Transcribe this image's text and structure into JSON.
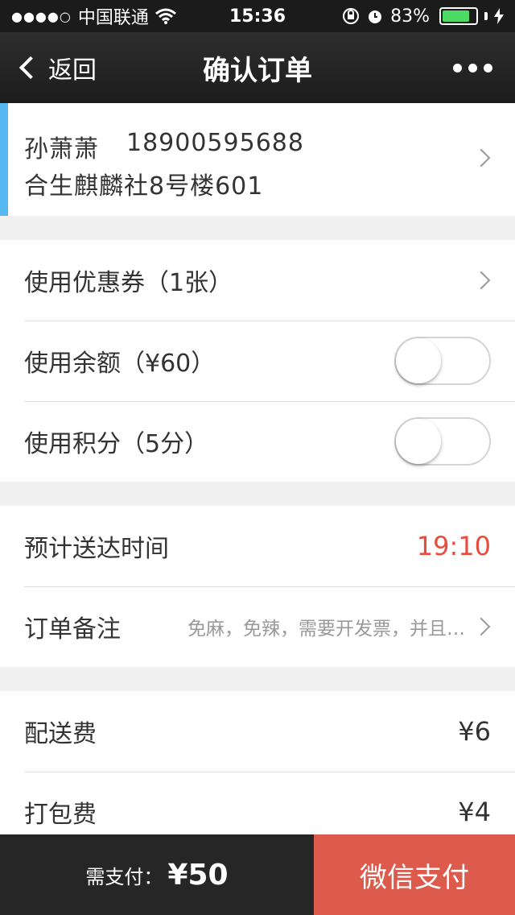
{
  "status_bar": {
    "signal": "●●●●○",
    "carrier": "中国联通",
    "wifi": "wifi-icon",
    "time": "15:36",
    "battery_percent": "83%",
    "battery_level": 0.83,
    "battery_color": "#4cd964"
  },
  "nav": {
    "back_label": "返回",
    "title": "确认订单"
  },
  "address": {
    "name": "孙萧萧",
    "phone": "18900595688",
    "detail": "合生麒麟社8号楼601",
    "accent_color": "#56b8f0"
  },
  "discounts": {
    "coupon_label": "使用优惠券（1张）",
    "balance_label": "使用余额（¥60）",
    "balance_on": false,
    "points_label": "使用积分（5分）",
    "points_on": false
  },
  "delivery": {
    "time_label": "预计送达时间",
    "time_value": "19:10",
    "time_color": "#e84c3d",
    "note_label": "订单备注",
    "note_text": "免麻，免辣，需要开发票，并且…"
  },
  "fees": {
    "delivery_label": "配送费",
    "delivery_value": "¥6",
    "packing_label": "打包费",
    "packing_value": "¥4"
  },
  "footer": {
    "pay_label": "需支付：",
    "pay_amount": "¥50",
    "pay_button": "微信支付",
    "pay_button_color": "#dc5b4c"
  }
}
